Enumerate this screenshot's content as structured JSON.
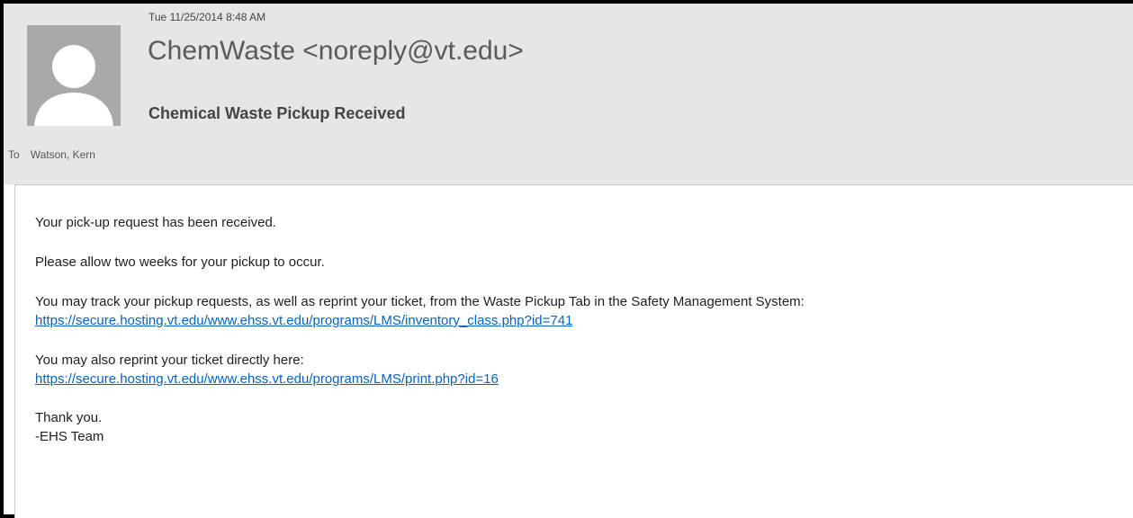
{
  "header": {
    "date": "Tue 11/25/2014 8:48 AM",
    "sender": "ChemWaste <noreply@vt.edu>",
    "subject": "Chemical Waste Pickup Received",
    "to_label": "To",
    "to_value": "Watson, Kern",
    "avatar_icon": "person-silhouette-icon"
  },
  "body": {
    "line1": "Your pick-up request has been received.",
    "line2": "Please allow two weeks for your pickup to occur.",
    "line3": "You may track your pickup requests, as well as reprint your ticket, from the Waste Pickup Tab in the Safety Management System:",
    "link1": "https://secure.hosting.vt.edu/www.ehss.vt.edu/programs/LMS/inventory_class.php?id=741",
    "line4": "You may also reprint your ticket directly here:",
    "link2": "https://secure.hosting.vt.edu/www.ehss.vt.edu/programs/LMS/print.php?id=16",
    "thanks": "Thank you.",
    "signature": "-EHS Team"
  },
  "colors": {
    "header_bg": "#e6e6e6",
    "link": "#0563c1",
    "avatar_bg": "#a9a9a9"
  }
}
